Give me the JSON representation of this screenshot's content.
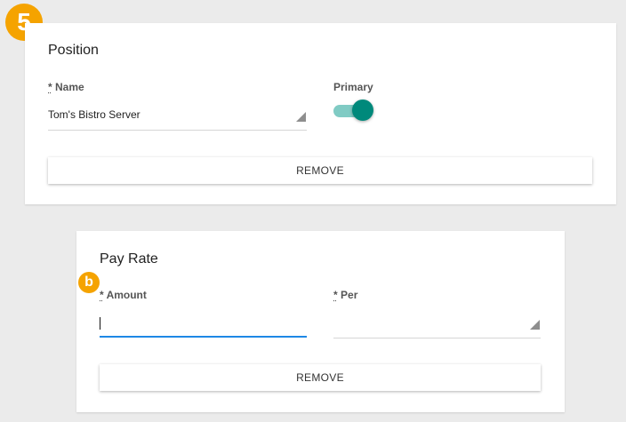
{
  "badges": {
    "step": "5",
    "field": "b"
  },
  "position_card": {
    "title": "Position",
    "name_field": {
      "required_mark": "*",
      "label": "Name",
      "value": "Tom's Bistro Server",
      "icon": "dropdown-arrow-icon"
    },
    "primary_toggle": {
      "label": "Primary",
      "on": true,
      "color": "#00897b"
    },
    "remove_button": "REMOVE"
  },
  "pay_rate_card": {
    "title": "Pay Rate",
    "amount_field": {
      "required_mark": "*",
      "label": "Amount",
      "value": "",
      "focused": true,
      "focus_color": "#1e88e5"
    },
    "per_field": {
      "required_mark": "*",
      "label": "Per",
      "value": "",
      "icon": "dropdown-arrow-icon"
    },
    "remove_button": "REMOVE"
  },
  "colors": {
    "badge": "#f5a300",
    "background": "#ebebeb"
  }
}
